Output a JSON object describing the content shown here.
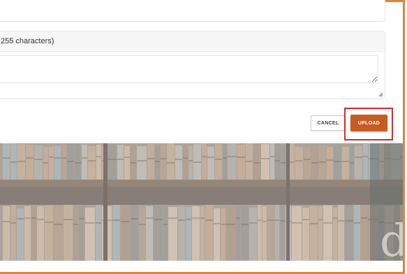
{
  "form": {
    "description_label": "255 characters)",
    "textarea_value": ""
  },
  "actions": {
    "cancel_label": "CANCEL",
    "upload_label": "UPLOAD"
  },
  "hero": {
    "visible_letter": "d"
  },
  "colors": {
    "accent": "#c85a22",
    "highlight": "#d12b2b",
    "frame": "#d9873f"
  }
}
